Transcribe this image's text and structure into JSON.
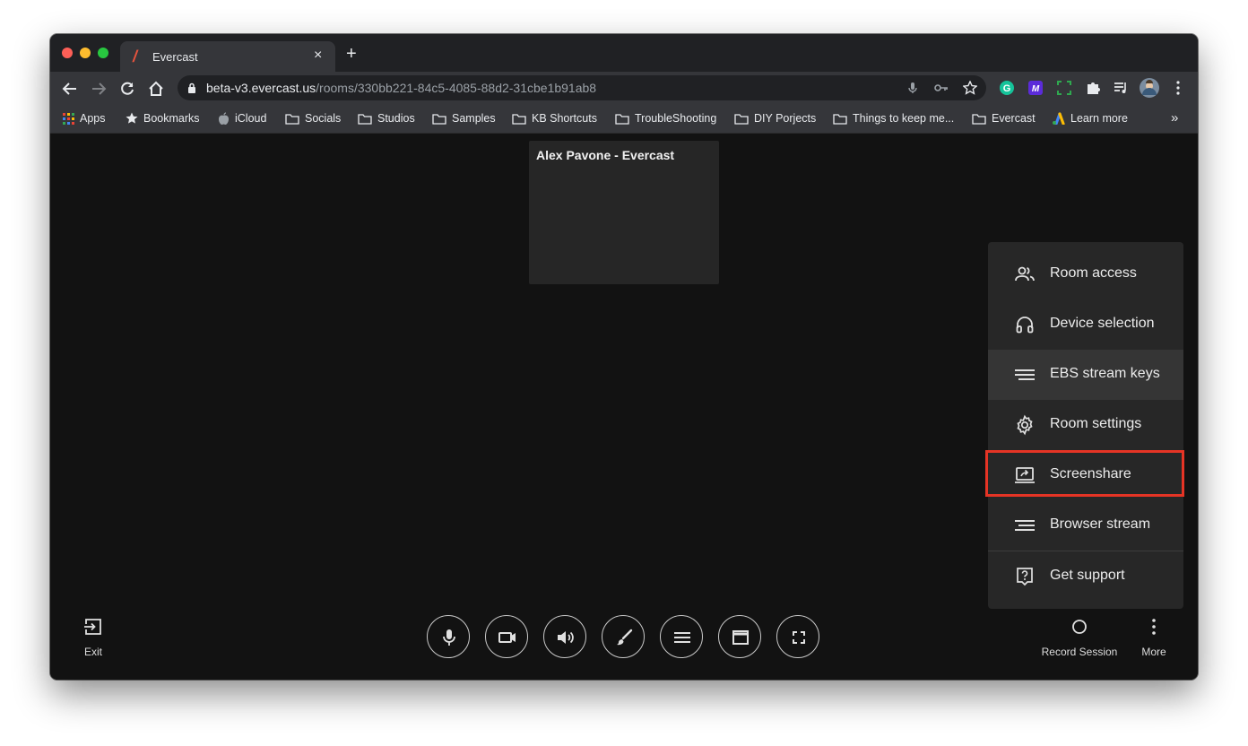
{
  "browser": {
    "tab_title": "Evercast",
    "tab_close": "×",
    "new_tab": "+",
    "url_host": "beta-v3.evercast.us",
    "url_path": "/rooms/330bb221-84c5-4085-88d2-31cbe1b91ab8"
  },
  "bookmarks": {
    "items": [
      "Apps",
      "Bookmarks",
      "iCloud",
      "Socials",
      "Studios",
      "Samples",
      "KB Shortcuts",
      "TroubleShooting",
      "DIY Porjects",
      "Things to keep me...",
      "Evercast",
      "Learn more"
    ],
    "more": "»"
  },
  "room": {
    "participant_name": "Alex Pavone - Evercast"
  },
  "menu": {
    "items": [
      {
        "label": "Room access",
        "icon": "people-icon"
      },
      {
        "label": "Device selection",
        "icon": "headphones-icon"
      },
      {
        "label": "EBS stream keys",
        "icon": "lines-icon"
      },
      {
        "label": "Room settings",
        "icon": "gear-icon"
      },
      {
        "label": "Screenshare",
        "icon": "screenshare-icon"
      },
      {
        "label": "Browser stream",
        "icon": "lines-icon"
      },
      {
        "label": "Get support",
        "icon": "help-icon"
      }
    ],
    "highlight_color": "#e53425"
  },
  "controls": {
    "exit_label": "Exit",
    "record_label": "Record Session",
    "more_label": "More"
  }
}
